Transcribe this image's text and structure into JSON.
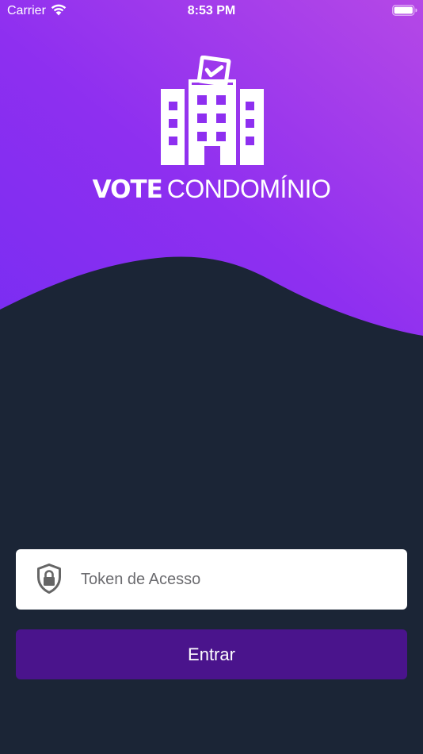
{
  "status_bar": {
    "carrier": "Carrier",
    "time": "8:53 PM",
    "icons": [
      "wifi-icon",
      "battery-icon"
    ]
  },
  "brand": {
    "name_bold": "VOTE",
    "name_light": "CONDOMÍNIO",
    "logo_icon": "building-ballot-icon"
  },
  "login": {
    "token_placeholder": "Token de Acesso",
    "token_value": "",
    "token_icon": "lock-shield-icon",
    "submit_label": "Entrar"
  },
  "colors": {
    "gradient_start": "#9b2ce6",
    "gradient_end": "#7b2ff0",
    "background": "#1b2536",
    "button": "#4a148c",
    "input_background": "#ffffff",
    "text_on_dark": "#ffffff"
  }
}
